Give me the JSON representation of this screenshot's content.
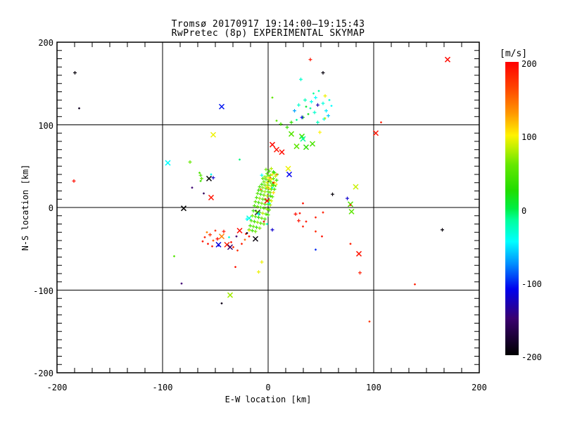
{
  "chart_data": {
    "type": "scatter",
    "title": "Tromsø 20170917 19:14:00–19:15:43",
    "subtitle": "RwPretec (8p) EXPERIMENTAL SKYMAP",
    "xlabel": "E-W location [km]",
    "ylabel": "N-S location [km]",
    "xlim": [
      -200,
      200
    ],
    "ylim": [
      -200,
      200
    ],
    "xticks": [
      -200,
      -100,
      0,
      100,
      200
    ],
    "yticks": [
      200,
      100,
      0,
      -100,
      -200
    ],
    "grid_x": [
      -100,
      0,
      100
    ],
    "grid_y": [
      -100,
      0,
      100
    ],
    "grid": true,
    "legend_position": "right-colorbar",
    "color_scale": {
      "label": "[m/s]",
      "min": -200,
      "max": 200,
      "ticks": [
        200,
        100,
        0,
        -100,
        -200
      ],
      "stops": [
        [
          -200,
          "#000000"
        ],
        [
          -150,
          "#3a0070"
        ],
        [
          -110,
          "#0000ee"
        ],
        [
          -75,
          "#0090ff"
        ],
        [
          -45,
          "#00ffff"
        ],
        [
          -15,
          "#00ff9a"
        ],
        [
          0,
          "#00ee44"
        ],
        [
          25,
          "#22dd00"
        ],
        [
          60,
          "#66e800"
        ],
        [
          85,
          "#c8f000"
        ],
        [
          100,
          "#fff200"
        ],
        [
          130,
          "#ff9800"
        ],
        [
          165,
          "#ff4400"
        ],
        [
          200,
          "#ff0000"
        ]
      ]
    },
    "points": [
      [
        -183,
        163,
        -195,
        "+"
      ],
      [
        -179,
        120,
        -185,
        "."
      ],
      [
        -184,
        32,
        195,
        "+"
      ],
      [
        170,
        179,
        195,
        "x"
      ],
      [
        40,
        179,
        190,
        "+"
      ],
      [
        52,
        163,
        -195,
        "+"
      ],
      [
        -44,
        122,
        -105,
        "x"
      ],
      [
        107,
        103,
        185,
        "."
      ],
      [
        102,
        90,
        190,
        "x"
      ],
      [
        165,
        -27,
        -195,
        "+"
      ],
      [
        139,
        -93,
        185,
        "."
      ],
      [
        96,
        -138,
        175,
        "."
      ],
      [
        -36,
        -106,
        75,
        "x"
      ],
      [
        -44,
        -116,
        -190,
        "."
      ],
      [
        4,
        133,
        55,
        "."
      ],
      [
        -52,
        88,
        95,
        "x"
      ],
      [
        -95,
        54,
        -45,
        "x"
      ],
      [
        -80,
        -1,
        -200,
        "x"
      ],
      [
        29,
        124,
        -30,
        "+"
      ],
      [
        35,
        130,
        -25,
        "+"
      ],
      [
        41,
        128,
        -40,
        "+"
      ],
      [
        45,
        133,
        -45,
        "+"
      ],
      [
        48,
        141,
        -20,
        "."
      ],
      [
        52,
        126,
        -35,
        "+"
      ],
      [
        55,
        117,
        -50,
        "+"
      ],
      [
        44,
        115,
        -30,
        "+"
      ],
      [
        38,
        113,
        15,
        "."
      ],
      [
        33,
        109,
        25,
        "+"
      ],
      [
        27,
        106,
        -15,
        "."
      ],
      [
        22,
        103,
        30,
        "+"
      ],
      [
        47,
        103,
        -25,
        "+"
      ],
      [
        53,
        107,
        -40,
        "+"
      ],
      [
        57,
        111,
        -60,
        "+"
      ],
      [
        60,
        123,
        -45,
        "."
      ],
      [
        31,
        155,
        -30,
        "+"
      ],
      [
        18,
        97,
        35,
        "+"
      ],
      [
        12,
        101,
        45,
        "+"
      ],
      [
        8,
        105,
        55,
        "."
      ],
      [
        25,
        117,
        -70,
        "+"
      ],
      [
        32,
        109,
        -110,
        "+"
      ],
      [
        47,
        124,
        -130,
        "+"
      ],
      [
        54,
        135,
        95,
        "+"
      ],
      [
        49,
        91,
        100,
        "+"
      ],
      [
        54,
        108,
        90,
        "."
      ],
      [
        40,
        120,
        -20,
        "."
      ],
      [
        36,
        122,
        5,
        "."
      ],
      [
        58,
        130,
        -35,
        "."
      ],
      [
        43,
        138,
        -15,
        "."
      ],
      [
        22,
        89,
        50,
        "x"
      ],
      [
        42,
        77,
        45,
        "x"
      ],
      [
        36,
        73,
        30,
        "x"
      ],
      [
        27,
        74,
        55,
        "x"
      ],
      [
        32,
        86,
        40,
        "x"
      ],
      [
        33,
        83,
        -15,
        "x"
      ],
      [
        4,
        76,
        195,
        "x"
      ],
      [
        8,
        70,
        190,
        "x"
      ],
      [
        13,
        67,
        195,
        "x"
      ],
      [
        -74,
        55,
        60,
        "+"
      ],
      [
        -65,
        42,
        45,
        "."
      ],
      [
        -64,
        39,
        50,
        "+"
      ],
      [
        -63,
        35,
        55,
        "+"
      ],
      [
        -64,
        32,
        40,
        "."
      ],
      [
        -56,
        35,
        -200,
        "x"
      ],
      [
        -52,
        36,
        -120,
        "+"
      ],
      [
        -54,
        40,
        -40,
        "."
      ],
      [
        -27,
        58,
        -10,
        "."
      ],
      [
        -72,
        24,
        -150,
        "."
      ],
      [
        -61,
        17,
        -160,
        "."
      ],
      [
        -54,
        12,
        190,
        "x"
      ],
      [
        -18,
        -13,
        -35,
        "x"
      ],
      [
        -10,
        -6,
        -170,
        "x"
      ],
      [
        -89,
        -59,
        50,
        "."
      ],
      [
        -47,
        -46,
        -110,
        "."
      ],
      [
        -82,
        -92,
        -150,
        "."
      ],
      [
        -2,
        46,
        60,
        "+"
      ],
      [
        1,
        44,
        45,
        "+"
      ],
      [
        3,
        47,
        80,
        "+"
      ],
      [
        5,
        43,
        30,
        "+"
      ],
      [
        -1,
        41,
        55,
        "+"
      ],
      [
        2,
        39,
        65,
        "+"
      ],
      [
        4,
        40,
        95,
        "+"
      ],
      [
        6,
        42,
        50,
        "+"
      ],
      [
        0,
        38,
        40,
        "+"
      ],
      [
        -3,
        37,
        70,
        "+"
      ],
      [
        7,
        38,
        85,
        "+"
      ],
      [
        9,
        40,
        60,
        "."
      ],
      [
        -5,
        35,
        50,
        "+"
      ],
      [
        -2,
        34,
        45,
        "+"
      ],
      [
        1,
        33,
        75,
        "+"
      ],
      [
        3,
        34,
        100,
        "+"
      ],
      [
        5,
        35,
        55,
        "+"
      ],
      [
        8,
        33,
        35,
        "+"
      ],
      [
        -4,
        31,
        60,
        "+"
      ],
      [
        -1,
        30,
        90,
        "+"
      ],
      [
        2,
        31,
        50,
        "+"
      ],
      [
        4,
        29,
        45,
        "+"
      ],
      [
        6,
        30,
        105,
        "+"
      ],
      [
        -6,
        28,
        40,
        "+"
      ],
      [
        -3,
        27,
        65,
        "+"
      ],
      [
        0,
        27,
        55,
        "+"
      ],
      [
        3,
        26,
        80,
        "+"
      ],
      [
        5,
        27,
        30,
        "+"
      ],
      [
        7,
        26,
        60,
        "."
      ],
      [
        -8,
        25,
        45,
        "+"
      ],
      [
        -5,
        24,
        70,
        "+"
      ],
      [
        -2,
        23,
        50,
        "+"
      ],
      [
        1,
        23,
        95,
        "+"
      ],
      [
        3,
        22,
        60,
        "+"
      ],
      [
        6,
        22,
        40,
        "+"
      ],
      [
        -9,
        21,
        35,
        "+"
      ],
      [
        -6,
        20,
        55,
        "+"
      ],
      [
        -3,
        19,
        75,
        "+"
      ],
      [
        0,
        19,
        45,
        "+"
      ],
      [
        2,
        18,
        65,
        "+"
      ],
      [
        5,
        18,
        110,
        "+"
      ],
      [
        -10,
        17,
        50,
        "+"
      ],
      [
        -7,
        16,
        40,
        "+"
      ],
      [
        -4,
        15,
        60,
        "+"
      ],
      [
        -1,
        14,
        85,
        "+"
      ],
      [
        2,
        14,
        35,
        "+"
      ],
      [
        4,
        13,
        55,
        "+"
      ],
      [
        -11,
        12,
        45,
        "+"
      ],
      [
        -8,
        11,
        70,
        "+"
      ],
      [
        -5,
        10,
        50,
        "+"
      ],
      [
        -2,
        9,
        30,
        "+"
      ],
      [
        1,
        9,
        60,
        "+"
      ],
      [
        3,
        8,
        90,
        "+"
      ],
      [
        -12,
        7,
        55,
        "+"
      ],
      [
        -9,
        6,
        40,
        "+"
      ],
      [
        -6,
        5,
        65,
        "+"
      ],
      [
        -3,
        4,
        50,
        "+"
      ],
      [
        0,
        4,
        35,
        "+"
      ],
      [
        2,
        3,
        75,
        "+"
      ],
      [
        -13,
        2,
        45,
        "+"
      ],
      [
        -10,
        1,
        60,
        "+"
      ],
      [
        -7,
        0,
        40,
        "+"
      ],
      [
        -4,
        -1,
        55,
        "+"
      ],
      [
        -1,
        -2,
        70,
        "+"
      ],
      [
        1,
        -3,
        50,
        "+"
      ],
      [
        -14,
        -4,
        35,
        "+"
      ],
      [
        -11,
        -5,
        60,
        "+"
      ],
      [
        -8,
        -6,
        45,
        "+"
      ],
      [
        -5,
        -7,
        80,
        "+"
      ],
      [
        -2,
        -8,
        55,
        "+"
      ],
      [
        0,
        -9,
        40,
        "+"
      ],
      [
        -15,
        -10,
        65,
        "+"
      ],
      [
        -12,
        -11,
        50,
        "+"
      ],
      [
        -9,
        -12,
        35,
        "+"
      ],
      [
        -6,
        -13,
        60,
        "+"
      ],
      [
        -3,
        -14,
        45,
        "+"
      ],
      [
        -16,
        -16,
        55,
        "+"
      ],
      [
        -13,
        -17,
        40,
        "+"
      ],
      [
        -10,
        -18,
        70,
        "+"
      ],
      [
        -7,
        -19,
        50,
        "+"
      ],
      [
        -4,
        -20,
        60,
        "+"
      ],
      [
        -17,
        -22,
        45,
        "+"
      ],
      [
        -14,
        -23,
        55,
        "+"
      ],
      [
        -11,
        -24,
        35,
        "+"
      ],
      [
        -8,
        -25,
        65,
        "+"
      ],
      [
        -18,
        -27,
        50,
        "+"
      ],
      [
        -15,
        -28,
        40,
        "+"
      ],
      [
        -12,
        -29,
        60,
        "+"
      ],
      [
        0,
        36,
        100,
        "+"
      ],
      [
        -1,
        25,
        105,
        "+"
      ],
      [
        8,
        28,
        100,
        "."
      ],
      [
        8,
        40,
        140,
        "."
      ],
      [
        2,
        36,
        150,
        "."
      ],
      [
        -7,
        22,
        145,
        "."
      ],
      [
        -1,
        8,
        190,
        "x"
      ],
      [
        5,
        30,
        185,
        "."
      ],
      [
        -4,
        -17,
        195,
        "."
      ],
      [
        -6,
        39,
        -40,
        "+"
      ],
      [
        1,
        5,
        -30,
        "+"
      ],
      [
        -9,
        -8,
        -35,
        "+"
      ],
      [
        -20,
        -14,
        -45,
        "+"
      ],
      [
        -1,
        -20,
        -25,
        "."
      ],
      [
        4,
        24,
        -30,
        "."
      ],
      [
        20,
        40,
        -110,
        "x"
      ],
      [
        19,
        47,
        95,
        "x"
      ],
      [
        -6,
        -66,
        95,
        "+"
      ],
      [
        -9,
        -78,
        95,
        "+"
      ],
      [
        -31,
        -72,
        190,
        "."
      ],
      [
        -27,
        -28,
        195,
        "x"
      ],
      [
        -44,
        -35,
        140,
        "x"
      ],
      [
        -42,
        -29,
        190,
        "+"
      ],
      [
        -37,
        -36,
        -35,
        "."
      ],
      [
        -30,
        -35,
        -150,
        "."
      ],
      [
        -12,
        -38,
        -195,
        "x"
      ],
      [
        -18,
        -35,
        190,
        "."
      ],
      [
        -39,
        -45,
        185,
        "x"
      ],
      [
        -47,
        -45,
        -115,
        "x"
      ],
      [
        -18,
        -28,
        100,
        "."
      ],
      [
        -52,
        -40,
        160,
        "."
      ],
      [
        -57,
        -44,
        190,
        "."
      ],
      [
        -60,
        -36,
        185,
        "."
      ],
      [
        -50,
        -28,
        180,
        "."
      ],
      [
        -55,
        -33,
        175,
        "+"
      ],
      [
        -35,
        -42,
        190,
        "."
      ],
      [
        -25,
        -44,
        185,
        "."
      ],
      [
        -22,
        -39,
        150,
        "."
      ],
      [
        -48,
        -38,
        195,
        "+"
      ],
      [
        -53,
        -47,
        185,
        "."
      ],
      [
        -58,
        -30,
        140,
        "."
      ],
      [
        -62,
        -41,
        190,
        "."
      ],
      [
        -33,
        -48,
        180,
        "."
      ],
      [
        -29,
        -52,
        175,
        "."
      ],
      [
        -21,
        -32,
        185,
        "."
      ],
      [
        -36,
        -48,
        -155,
        "x"
      ],
      [
        -20,
        -31,
        -190,
        "."
      ],
      [
        33,
        5,
        190,
        "."
      ],
      [
        52,
        -6,
        185,
        "."
      ],
      [
        26,
        -8,
        195,
        "+"
      ],
      [
        30,
        -7,
        190,
        "."
      ],
      [
        45,
        -12,
        185,
        "."
      ],
      [
        36,
        -17,
        190,
        "."
      ],
      [
        29,
        -16,
        190,
        "+"
      ],
      [
        33,
        -23,
        185,
        "."
      ],
      [
        45,
        -29,
        180,
        "."
      ],
      [
        51,
        -35,
        190,
        "."
      ],
      [
        78,
        -44,
        185,
        "."
      ],
      [
        45,
        -51,
        -100,
        "."
      ],
      [
        86,
        -56,
        190,
        "x"
      ],
      [
        87,
        -79,
        185,
        "+"
      ],
      [
        61,
        16,
        -195,
        "+"
      ],
      [
        75,
        11,
        -120,
        "+"
      ],
      [
        83,
        25,
        85,
        "x"
      ],
      [
        78,
        4,
        50,
        "x"
      ],
      [
        79,
        -5,
        55,
        "x"
      ],
      [
        78,
        3,
        190,
        "."
      ],
      [
        4,
        -27,
        -120,
        "+"
      ]
    ]
  }
}
